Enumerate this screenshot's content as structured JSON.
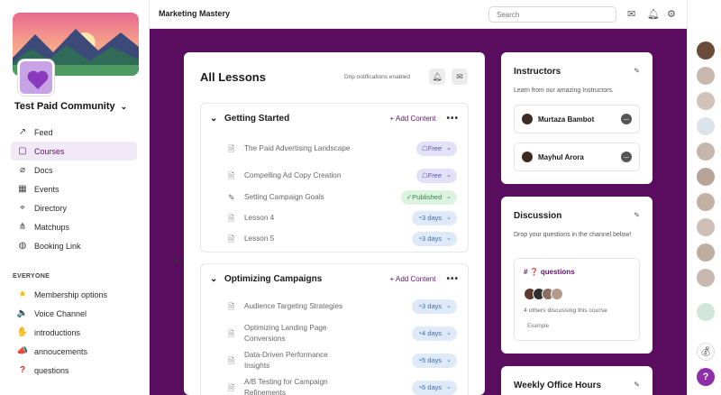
{
  "sidebar": {
    "community_name": "Test Paid Community",
    "nav": [
      {
        "label": "Feed",
        "icon": "trend-icon"
      },
      {
        "label": "Courses",
        "icon": "book-icon",
        "active": true
      },
      {
        "label": "Docs",
        "icon": "paperclip-icon"
      },
      {
        "label": "Events",
        "icon": "calendar-icon"
      },
      {
        "label": "Directory",
        "icon": "pin-icon"
      },
      {
        "label": "Matchups",
        "icon": "share-icon"
      },
      {
        "label": "Booking Link",
        "icon": "globe-icon"
      }
    ],
    "section_label": "EVERYONE",
    "channels": [
      {
        "label": "Membership options",
        "icon": "star-emoji"
      },
      {
        "label": "Voice Channel",
        "icon": "speaker-emoji"
      },
      {
        "label": "introductions",
        "icon": "wave-emoji"
      },
      {
        "label": "annoucements",
        "icon": "megaphone-emoji"
      },
      {
        "label": "questions",
        "icon": "question-emoji"
      }
    ]
  },
  "topbar": {
    "title": "Marketing Mastery",
    "search_placeholder": "Search"
  },
  "lessons": {
    "heading": "All Lessons",
    "drip_text": "Drip notifications enabled",
    "sections": [
      {
        "title": "Getting Started",
        "add_label": "+ Add Content",
        "items": [
          {
            "title": "The Paid Advertising Landscape",
            "badge": "Free",
            "type": "free",
            "icon": "doc"
          },
          {
            "title": "Compelling Ad Copy Creation",
            "badge": "Free",
            "type": "free",
            "icon": "doc"
          },
          {
            "title": "Setting Campaign Goals",
            "badge": "Published",
            "type": "pub",
            "icon": "pen"
          },
          {
            "title": "Lesson 4",
            "badge": "3 days",
            "type": "days",
            "icon": "doc"
          },
          {
            "title": "Lesson 5",
            "badge": "3 days",
            "type": "days",
            "icon": "doc"
          }
        ]
      },
      {
        "title": "Optimizing Campaigns",
        "add_label": "+ Add Content",
        "items": [
          {
            "title": "Audience Targeting Strategies",
            "badge": "3 days",
            "type": "days",
            "icon": "doc"
          },
          {
            "title": "Optimizing Landing Page Conversions",
            "badge": "4 days",
            "type": "days",
            "icon": "doc"
          },
          {
            "title": "Data-Driven Performance Insights",
            "badge": "5 days",
            "type": "days",
            "icon": "doc"
          },
          {
            "title": "A/B Testing for Campaign Refinements",
            "badge": "6 days",
            "type": "days",
            "icon": "doc"
          }
        ]
      }
    ]
  },
  "instructors": {
    "title": "Instructors",
    "desc": "Learn from our amazing Instructors.",
    "people": [
      "Murtaza Bambot",
      "Mayhul Arora"
    ]
  },
  "discussion": {
    "title": "Discussion",
    "desc": "Drop your questions in the channel below!",
    "channel": "# ❓ questions",
    "discussing": "4 others discussing this course",
    "example": "Example"
  },
  "office_hours": {
    "title": "Weekly Office Hours"
  },
  "colors": {
    "brand": "#5a0d5e",
    "accent": "#5d1468"
  }
}
